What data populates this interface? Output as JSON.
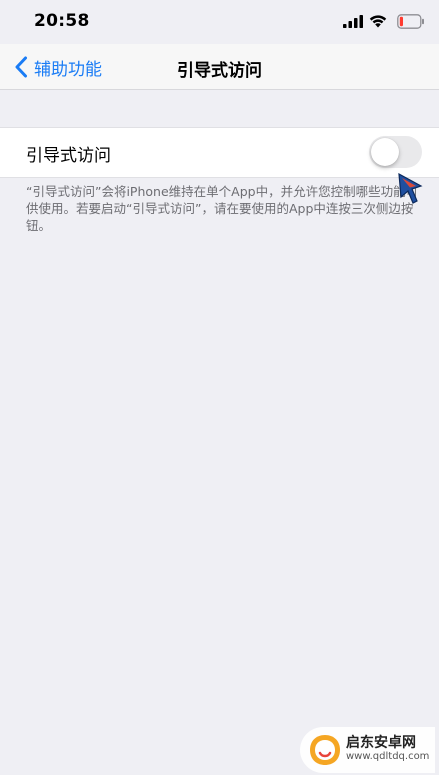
{
  "status_bar": {
    "time": "20:58",
    "icons": [
      "signal-icon",
      "wifi-icon",
      "battery-icon"
    ],
    "battery_color": "#ff3b30"
  },
  "nav": {
    "back_label": "辅助功能",
    "title": "引导式访问",
    "accent_color": "#1a7cf5"
  },
  "settings": {
    "guided_access_label": "引导式访问",
    "toggle_on": false
  },
  "footer": {
    "text": "“引导式访问”会将iPhone维持在单个App中，并允许您控制哪些功能可供使用。若要启动“引导式访问”，请在要使用的App中连按三次侧边按钮。"
  },
  "watermark": {
    "title": "启东安卓网",
    "url": "www.qdltdq.com"
  }
}
